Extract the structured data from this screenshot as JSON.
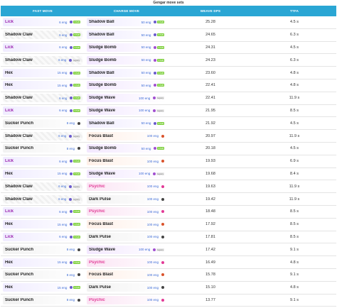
{
  "title": "Gengar move sets",
  "headers": {
    "fast": "FAST MOVE",
    "charge": "CHARGE MOVE",
    "dps": "WEAVE DPS",
    "ttfa": "TTFA"
  },
  "rows": [
    {
      "fast": "Lick",
      "fast_eng": "6 eng",
      "fast_tag": "STAB",
      "charge": "Shadow Ball",
      "charge_eng": "50 eng",
      "charge_tag": "STAB",
      "dps": "25.28",
      "ttfa": "4.5 s"
    },
    {
      "fast": "Shadow Claw",
      "fast_eng": "6 eng",
      "fast_tag": "STAB",
      "charge": "Shadow Ball",
      "charge_eng": "50 eng",
      "charge_tag": "STAB",
      "dps": "24.65",
      "ttfa": "6.3 s"
    },
    {
      "fast": "Lick",
      "fast_eng": "6 eng",
      "fast_tag": "STAB",
      "charge": "Sludge Bomb",
      "charge_eng": "50 eng",
      "charge_tag": "STAB",
      "dps": "24.31",
      "ttfa": "4.5 s"
    },
    {
      "fast": "Shadow Claw",
      "fast_eng": "6 eng",
      "fast_tag": "legacy",
      "charge": "Sludge Bomb",
      "charge_eng": "50 eng",
      "charge_tag": "STAB",
      "dps": "24.23",
      "ttfa": "6.3 s"
    },
    {
      "fast": "Hex",
      "fast_eng": "15 eng",
      "fast_tag": "STAB",
      "charge": "Shadow Ball",
      "charge_eng": "50 eng",
      "charge_tag": "STAB",
      "dps": "23.60",
      "ttfa": "4.8 s"
    },
    {
      "fast": "Hex",
      "fast_eng": "15 eng",
      "fast_tag": "STAB",
      "charge": "Sludge Bomb",
      "charge_eng": "50 eng",
      "charge_tag": "STAB",
      "dps": "22.41",
      "ttfa": "4.8 s"
    },
    {
      "fast": "Shadow Claw",
      "fast_eng": "6 eng",
      "fast_tag": "STAB",
      "charge": "Sludge Wave",
      "charge_eng": "100 eng",
      "charge_tag": "legacy",
      "dps": "22.41",
      "ttfa": "11.9 s"
    },
    {
      "fast": "Lick",
      "fast_eng": "6 eng",
      "fast_tag": "STAB",
      "charge": "Sludge Wave",
      "charge_eng": "100 eng",
      "charge_tag": "legacy",
      "dps": "21.95",
      "ttfa": "8.5 s"
    },
    {
      "fast": "Sucker Punch",
      "fast_eng": "8 eng",
      "fast_tag": "",
      "charge": "Shadow Ball",
      "charge_eng": "50 eng",
      "charge_tag": "STAB",
      "dps": "21.92",
      "ttfa": "4.5 s"
    },
    {
      "fast": "Shadow Claw",
      "fast_eng": "6 eng",
      "fast_tag": "legacy",
      "charge": "Focus Blast",
      "charge_eng": "100 eng",
      "charge_tag": "",
      "dps": "20.97",
      "ttfa": "11.9 s"
    },
    {
      "fast": "Sucker Punch",
      "fast_eng": "8 eng",
      "fast_tag": "",
      "charge": "Sludge Bomb",
      "charge_eng": "50 eng",
      "charge_tag": "STAB",
      "dps": "20.18",
      "ttfa": "4.5 s"
    },
    {
      "fast": "Lick",
      "fast_eng": "6 eng",
      "fast_tag": "STAB",
      "charge": "Focus Blast",
      "charge_eng": "100 eng",
      "charge_tag": "",
      "dps": "19.93",
      "ttfa": "6.9 s"
    },
    {
      "fast": "Hex",
      "fast_eng": "15 eng",
      "fast_tag": "STAB",
      "charge": "Sludge Wave",
      "charge_eng": "100 eng",
      "charge_tag": "legacy",
      "dps": "19.68",
      "ttfa": "8.4 s"
    },
    {
      "fast": "Shadow Claw",
      "fast_eng": "6 eng",
      "fast_tag": "legacy",
      "charge": "Psychic",
      "charge_eng": "100 eng",
      "charge_tag": "",
      "dps": "19.63",
      "ttfa": "11.9 s"
    },
    {
      "fast": "Shadow Claw",
      "fast_eng": "6 eng",
      "fast_tag": "legacy",
      "charge": "Dark Pulse",
      "charge_eng": "100 eng",
      "charge_tag": "",
      "dps": "19.42",
      "ttfa": "11.9 s"
    },
    {
      "fast": "Lick",
      "fast_eng": "6 eng",
      "fast_tag": "STAB",
      "charge": "Psychic",
      "charge_eng": "100 eng",
      "charge_tag": "",
      "dps": "18.48",
      "ttfa": "8.5 s"
    },
    {
      "fast": "Hex",
      "fast_eng": "15 eng",
      "fast_tag": "STAB",
      "charge": "Focus Blast",
      "charge_eng": "100 eng",
      "charge_tag": "",
      "dps": "17.92",
      "ttfa": "8.5 s"
    },
    {
      "fast": "Lick",
      "fast_eng": "6 eng",
      "fast_tag": "STAB",
      "charge": "Dark Pulse",
      "charge_eng": "100 eng",
      "charge_tag": "",
      "dps": "17.81",
      "ttfa": "8.5 s"
    },
    {
      "fast": "Sucker Punch",
      "fast_eng": "8 eng",
      "fast_tag": "",
      "charge": "Sludge Wave",
      "charge_eng": "100 eng",
      "charge_tag": "legacy",
      "dps": "17.42",
      "ttfa": "9.1 s"
    },
    {
      "fast": "Hex",
      "fast_eng": "15 eng",
      "fast_tag": "STAB",
      "charge": "Psychic",
      "charge_eng": "100 eng",
      "charge_tag": "",
      "dps": "16.49",
      "ttfa": "4.8 s"
    },
    {
      "fast": "Sucker Punch",
      "fast_eng": "8 eng",
      "fast_tag": "",
      "charge": "Focus Blast",
      "charge_eng": "100 eng",
      "charge_tag": "",
      "dps": "15.78",
      "ttfa": "9.1 s"
    },
    {
      "fast": "Hex",
      "fast_eng": "15 eng",
      "fast_tag": "STAB",
      "charge": "Dark Pulse",
      "charge_eng": "100 eng",
      "charge_tag": "",
      "dps": "15.10",
      "ttfa": "4.8 s"
    },
    {
      "fast": "Sucker Punch",
      "fast_eng": "8 eng",
      "fast_tag": "",
      "charge": "Psychic",
      "charge_eng": "100 eng",
      "charge_tag": "",
      "dps": "13.77",
      "ttfa": "9.1 s"
    }
  ],
  "colors": {
    "header_bg": "#2aa6d4",
    "lick": "#9c27b0",
    "psychic": "#e23a96",
    "stab": "#7ccf3a"
  }
}
